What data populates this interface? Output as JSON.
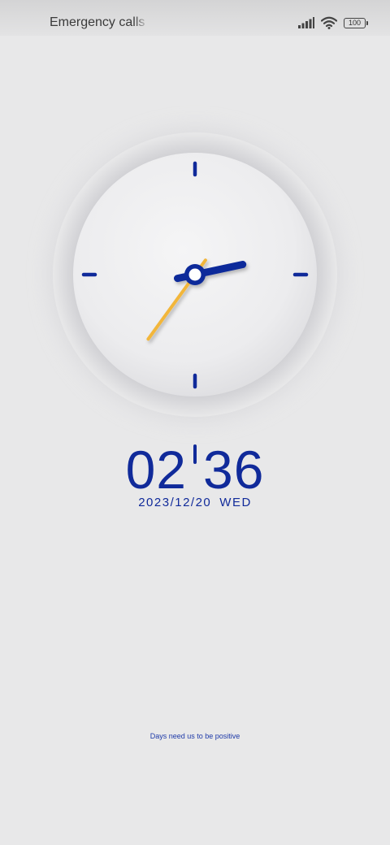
{
  "status_bar": {
    "carrier_text": "Emergency calls only",
    "signal_icon": "signal-bars-icon",
    "wifi_icon": "wifi-icon",
    "battery_level": "100"
  },
  "clock": {
    "analog": {
      "hour": 2,
      "minute": 36
    },
    "colors": {
      "face": "#ececed",
      "accent": "#102a9a",
      "second_hand": "#f2b63b"
    }
  },
  "digital": {
    "hours": "02",
    "minutes": "36",
    "date": "2023/12/20",
    "weekday": "WED"
  },
  "quote": "Days need us to be positive"
}
